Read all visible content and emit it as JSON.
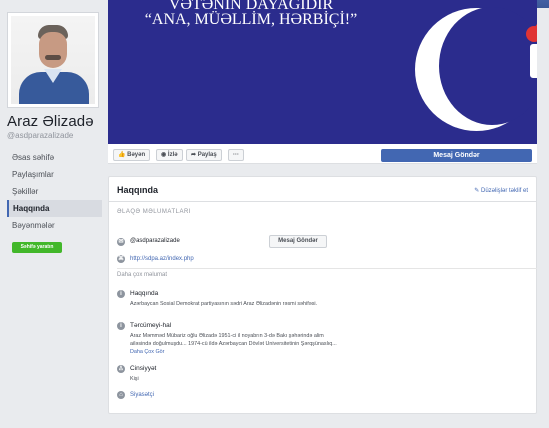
{
  "profile": {
    "name": "Araz Əlizadə",
    "handle": "@asdparazalizade"
  },
  "sidebar": {
    "items": [
      {
        "label": "Əsas səhifə"
      },
      {
        "label": "Paylaşımlar"
      },
      {
        "label": "Şəkillər"
      },
      {
        "label": "Haqqında"
      },
      {
        "label": "Bəyənmələr"
      }
    ],
    "create_page_label": "Səhifə yaratın"
  },
  "cover": {
    "title_line_1": "VƏTƏNIN DAYAĞIDIR",
    "title_line_2": "“ANA, MÜƏLLİM, HƏRBİÇİ!”",
    "colors": {
      "background": "#2b2c8d",
      "rose": "#e03434"
    },
    "icons": [
      "crescent-icon",
      "rose-icon",
      "fist-icon"
    ]
  },
  "actions": {
    "like": "Bəyən",
    "follow": "İzlə",
    "share": "Paylaş",
    "more": "···",
    "message": "Mesaj Göndər"
  },
  "about": {
    "title": "Haqqında",
    "suggest_edit": "Düzəlişlər təklif et",
    "contact_header": "ƏLAQƏ MƏLUMATLARI",
    "contact_handle": "@asdparazalizade",
    "message_button": "Mesaj Göndər",
    "website": "http://sdpa.az/index.php",
    "more_info": "Daha çox məlumat",
    "about_title": "Haqqında",
    "about_text": "Azərbaycan Sosial Demokrat partiyasının sədri Araz Əlizadənin rəsmi səhifəsi.",
    "biography_title": "Tərcümeyi-hal",
    "biography_text": "Araz Məmməd Mübariz oğlu Əlizadə 1951-ci il noyabrın 3-də Bakı şəhərində alim ailəsində doğulmuşdu... 1974-cü ildə Azərbaycan Dövlət Universitetinin Şərqşünaslıq...",
    "biography_more": "Daha Çox Gör",
    "gender_title": "Cinsiyyət",
    "gender_value": "Kişi",
    "category": "Siyasətçi"
  }
}
